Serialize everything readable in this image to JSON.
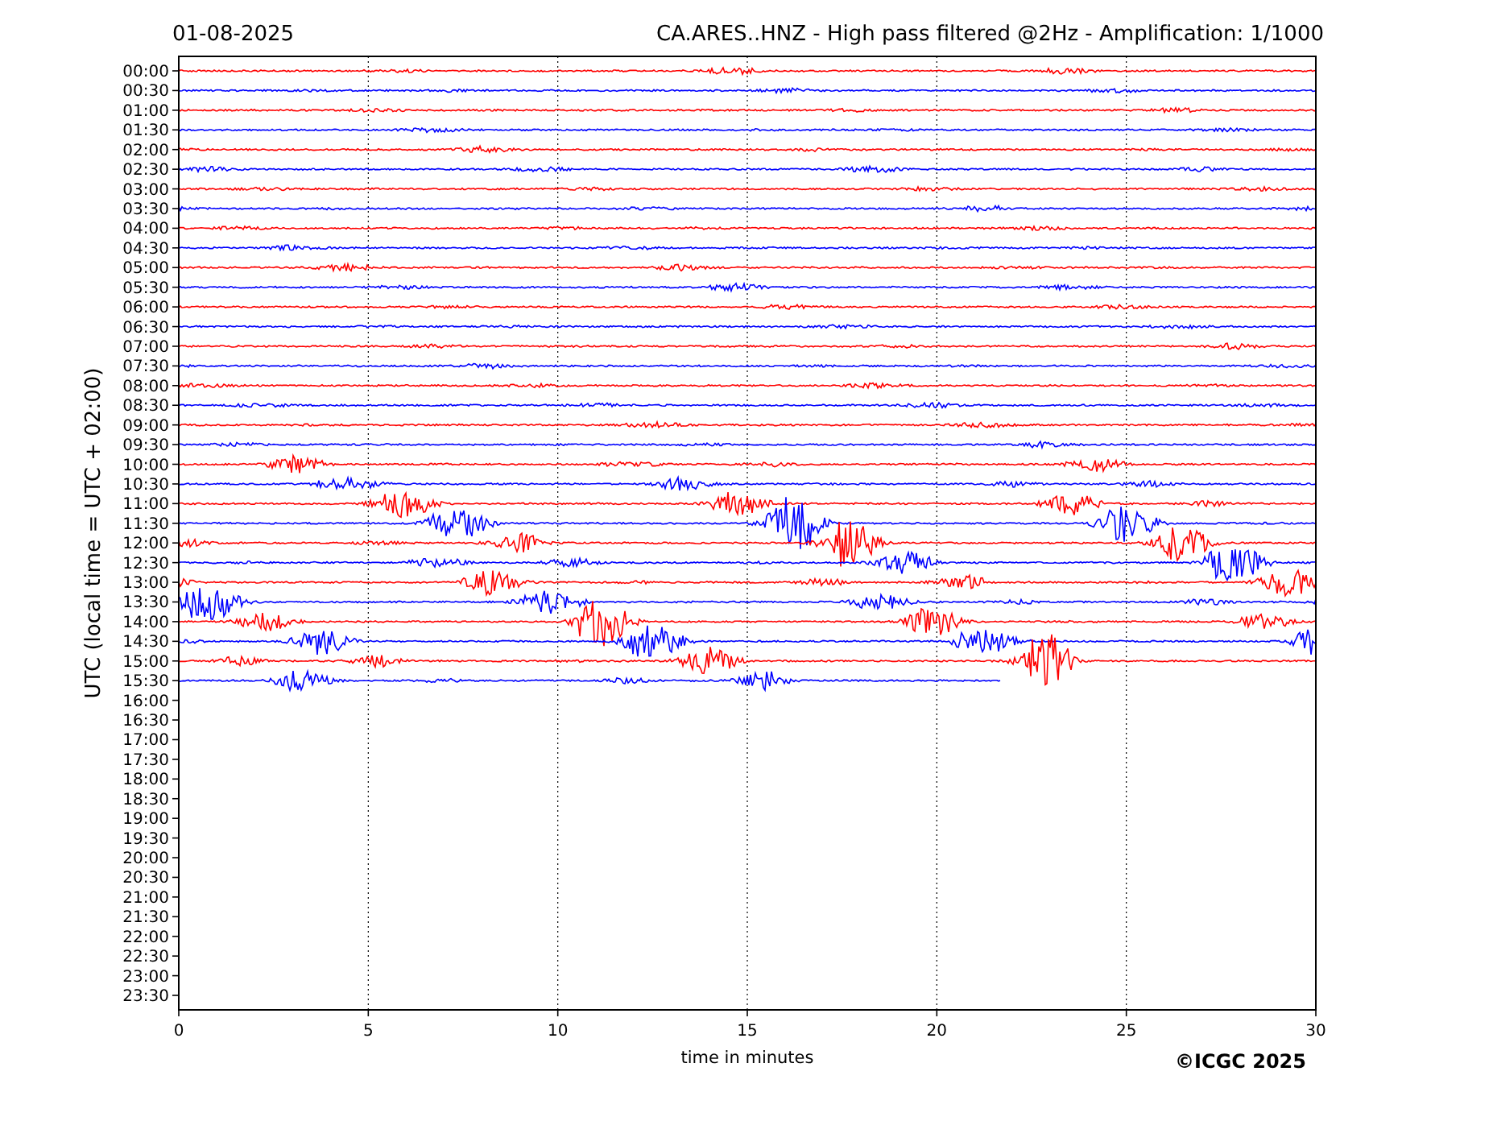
{
  "date": "01-08-2025",
  "title": "CA.ARES..HNZ - High pass filtered @2Hz - Amplification: 1/1000",
  "plot": {
    "ylabel": "UTC (local time = UTC + 02:00)",
    "xlabel": "time in minutes",
    "xticks": [
      "0",
      "5",
      "10",
      "15",
      "20",
      "25",
      "30"
    ],
    "rows": [
      {
        "label": "00:00",
        "color": "#ff0000"
      },
      {
        "label": "00:30",
        "color": "#0000ff"
      },
      {
        "label": "01:00",
        "color": "#ff0000"
      },
      {
        "label": "01:30",
        "color": "#0000ff"
      },
      {
        "label": "02:00",
        "color": "#ff0000"
      },
      {
        "label": "02:30",
        "color": "#0000ff"
      },
      {
        "label": "03:00",
        "color": "#ff0000"
      },
      {
        "label": "03:30",
        "color": "#0000ff"
      },
      {
        "label": "04:00",
        "color": "#ff0000"
      },
      {
        "label": "04:30",
        "color": "#0000ff"
      },
      {
        "label": "05:00",
        "color": "#ff0000"
      },
      {
        "label": "05:30",
        "color": "#0000ff"
      },
      {
        "label": "06:00",
        "color": "#ff0000"
      },
      {
        "label": "06:30",
        "color": "#0000ff"
      },
      {
        "label": "07:00",
        "color": "#ff0000"
      },
      {
        "label": "07:30",
        "color": "#0000ff"
      },
      {
        "label": "08:00",
        "color": "#ff0000"
      },
      {
        "label": "08:30",
        "color": "#0000ff"
      },
      {
        "label": "09:00",
        "color": "#ff0000"
      },
      {
        "label": "09:30",
        "color": "#0000ff"
      },
      {
        "label": "10:00",
        "color": "#ff0000"
      },
      {
        "label": "10:30",
        "color": "#0000ff"
      },
      {
        "label": "11:00",
        "color": "#ff0000"
      },
      {
        "label": "11:30",
        "color": "#0000ff"
      },
      {
        "label": "12:00",
        "color": "#ff0000"
      },
      {
        "label": "12:30",
        "color": "#0000ff"
      },
      {
        "label": "13:00",
        "color": "#ff0000"
      },
      {
        "label": "13:30",
        "color": "#0000ff"
      },
      {
        "label": "14:00",
        "color": "#ff0000"
      },
      {
        "label": "14:30",
        "color": "#0000ff"
      },
      {
        "label": "15:00",
        "color": "#ff0000"
      },
      {
        "label": "15:30",
        "color": "#0000ff"
      },
      {
        "label": "16:00"
      },
      {
        "label": "16:30"
      },
      {
        "label": "17:00"
      },
      {
        "label": "17:30"
      },
      {
        "label": "18:00"
      },
      {
        "label": "18:30"
      },
      {
        "label": "19:00"
      },
      {
        "label": "19:30"
      },
      {
        "label": "20:00"
      },
      {
        "label": "20:30"
      },
      {
        "label": "21:00"
      },
      {
        "label": "21:30"
      },
      {
        "label": "22:00"
      },
      {
        "label": "22:30"
      },
      {
        "label": "23:00"
      },
      {
        "label": "23:30"
      }
    ]
  },
  "copyright": "©ICGC 2025"
}
